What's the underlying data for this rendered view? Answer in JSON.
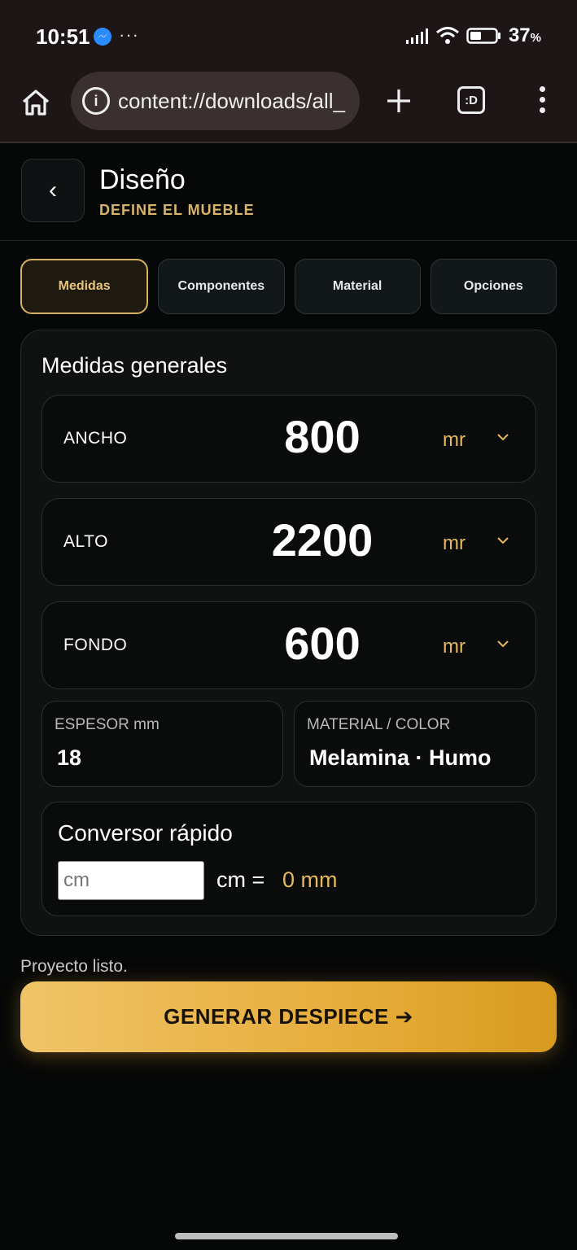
{
  "status_bar": {
    "time": "10:51",
    "overflow": "···",
    "battery_pct": "37",
    "battery_unit": "%",
    "icons": [
      "messenger-icon",
      "signal-icon",
      "wifi-icon",
      "battery-icon"
    ]
  },
  "browser": {
    "url": "content://downloads/all_",
    "tabs_label": ":D",
    "icons": [
      "home-icon",
      "info-icon",
      "plus-icon",
      "tabs-icon",
      "menu-icon"
    ]
  },
  "header": {
    "back": "‹",
    "title": "Diseño",
    "subtitle": "DEFINE EL MUEBLE"
  },
  "tabs": [
    {
      "label": "Medidas",
      "active": true
    },
    {
      "label": "Componentes",
      "active": false
    },
    {
      "label": "Material",
      "active": false
    },
    {
      "label": "Opciones",
      "active": false
    }
  ],
  "medidas": {
    "title": "Medidas generales",
    "rows": [
      {
        "label": "ANCHO",
        "value": "800",
        "unit": "mr"
      },
      {
        "label": "ALTO",
        "value": "2200",
        "unit": "mr"
      },
      {
        "label": "FONDO",
        "value": "600",
        "unit": "mr"
      }
    ],
    "espesor": {
      "label": "ESPESOR mm",
      "value": "18"
    },
    "material": {
      "label": "MATERIAL / COLOR",
      "value": "Melamina · Humo"
    }
  },
  "conversor": {
    "title": "Conversor rápido",
    "placeholder": "cm",
    "eq": "cm =",
    "result": "0 mm"
  },
  "status_text": "Proyecto listo.",
  "cta_label": "GENERAR DESPIECE ➔",
  "colors": {
    "accent": "#e6b95e",
    "background": "#060707",
    "card": "#101212"
  }
}
